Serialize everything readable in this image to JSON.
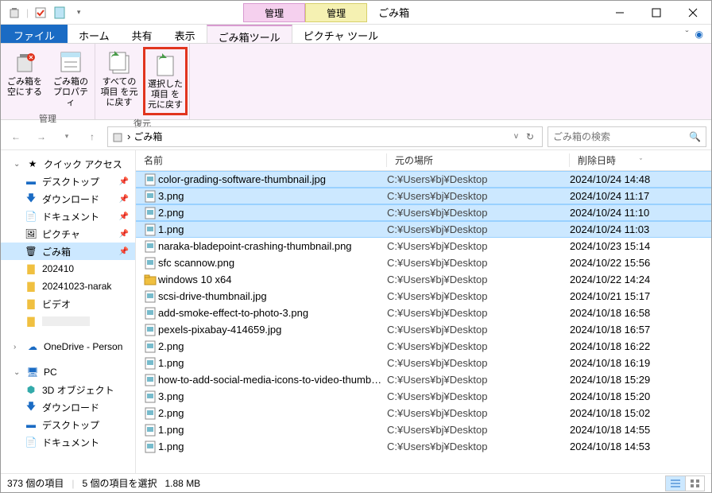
{
  "window": {
    "title": "ごみ箱"
  },
  "title_tabs": {
    "pink": "管理",
    "yellow": "管理"
  },
  "tabs": {
    "file": "ファイル",
    "home": "ホーム",
    "share": "共有",
    "view": "表示",
    "recycle_tools": "ごみ箱ツール",
    "picture_tools": "ピクチャ ツール"
  },
  "ribbon": {
    "group_manage": "管理",
    "group_restore": "復元",
    "empty_bin": "ごみ箱を\n空にする",
    "bin_props": "ごみ箱の\nプロパティ",
    "restore_all": "すべての項目\nを元に戻す",
    "restore_sel": "選択した項目\nを元に戻す"
  },
  "address": {
    "location": "ごみ箱"
  },
  "search": {
    "placeholder": "ごみ箱の検索"
  },
  "nav": {
    "quick": "クイック アクセス",
    "desktop": "デスクトップ",
    "downloads": "ダウンロード",
    "documents": "ドキュメント",
    "pictures": "ピクチャ",
    "recycle": "ごみ箱",
    "f202410": "202410",
    "f20241023": "20241023-narak",
    "video": "ビデオ",
    "blurred": "",
    "onedrive": "OneDrive - Person",
    "pc": "PC",
    "objects3d": "3D オブジェクト",
    "dl2": "ダウンロード",
    "desk2": "デスクトップ",
    "docs2": "ドキュメント"
  },
  "cols": {
    "name": "名前",
    "loc": "元の場所",
    "date": "削除日時"
  },
  "chart_data": {
    "type": "table",
    "columns": [
      "name",
      "location",
      "deleted",
      "selected"
    ],
    "rows": [
      {
        "name": "color-grading-software-thumbnail.jpg",
        "location": "C:¥Users¥bj¥Desktop",
        "deleted": "2024/10/24 14:48",
        "selected": true
      },
      {
        "name": "3.png",
        "location": "C:¥Users¥bj¥Desktop",
        "deleted": "2024/10/24 11:17",
        "selected": true
      },
      {
        "name": "2.png",
        "location": "C:¥Users¥bj¥Desktop",
        "deleted": "2024/10/24 11:10",
        "selected": true
      },
      {
        "name": "1.png",
        "location": "C:¥Users¥bj¥Desktop",
        "deleted": "2024/10/24 11:03",
        "selected": true
      },
      {
        "name": "naraka-bladepoint-crashing-thumbnail.png",
        "location": "C:¥Users¥bj¥Desktop",
        "deleted": "2024/10/23 15:14",
        "selected": false
      },
      {
        "name": "sfc scannow.png",
        "location": "C:¥Users¥bj¥Desktop",
        "deleted": "2024/10/22 15:56",
        "selected": false
      },
      {
        "name": "windows 10 x64",
        "location": "C:¥Users¥bj¥Desktop",
        "deleted": "2024/10/22 14:24",
        "selected": false
      },
      {
        "name": "scsi-drive-thumbnail.jpg",
        "location": "C:¥Users¥bj¥Desktop",
        "deleted": "2024/10/21 15:17",
        "selected": false
      },
      {
        "name": "add-smoke-effect-to-photo-3.png",
        "location": "C:¥Users¥bj¥Desktop",
        "deleted": "2024/10/18 16:58",
        "selected": false
      },
      {
        "name": "pexels-pixabay-414659.jpg",
        "location": "C:¥Users¥bj¥Desktop",
        "deleted": "2024/10/18 16:57",
        "selected": false
      },
      {
        "name": "2.png",
        "location": "C:¥Users¥bj¥Desktop",
        "deleted": "2024/10/18 16:22",
        "selected": false
      },
      {
        "name": "1.png",
        "location": "C:¥Users¥bj¥Desktop",
        "deleted": "2024/10/18 16:19",
        "selected": false
      },
      {
        "name": "how-to-add-social-media-icons-to-video-thumbnail...",
        "location": "C:¥Users¥bj¥Desktop",
        "deleted": "2024/10/18 15:29",
        "selected": false
      },
      {
        "name": "3.png",
        "location": "C:¥Users¥bj¥Desktop",
        "deleted": "2024/10/18 15:20",
        "selected": false
      },
      {
        "name": "2.png",
        "location": "C:¥Users¥bj¥Desktop",
        "deleted": "2024/10/18 15:02",
        "selected": false
      },
      {
        "name": "1.png",
        "location": "C:¥Users¥bj¥Desktop",
        "deleted": "2024/10/18 14:55",
        "selected": false
      },
      {
        "name": "1.png",
        "location": "C:¥Users¥bj¥Desktop",
        "deleted": "2024/10/18 14:53",
        "selected": false
      }
    ]
  },
  "status": {
    "items": "373 個の項目",
    "selected": "5 個の項目を選択",
    "size": "1.88 MB"
  }
}
